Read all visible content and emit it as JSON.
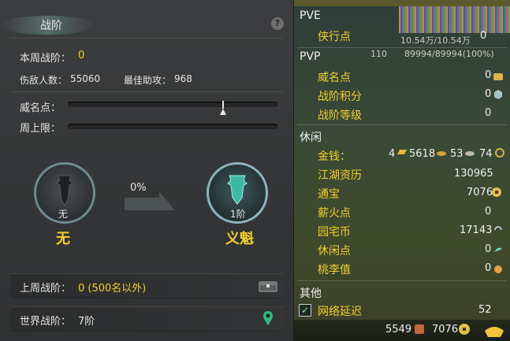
{
  "left": {
    "title": "战阶",
    "help": "?",
    "weekly_rank_label": "本周战阶：",
    "weekly_rank_value": "0",
    "kills_label": "伤敌人数：",
    "kills_value": "55060",
    "assists_label": "最佳助攻：",
    "assists_value": "968",
    "fame_label": "威名点：",
    "weekly_cap_label": "周上限：",
    "fame_progress": 0.74,
    "current_rank_small": "无",
    "current_rank_name": "无",
    "progress_percent": "0%",
    "next_rank_small": "1阶",
    "next_rank_name": "义魁",
    "last_week_label": "上周战阶：",
    "last_week_value": "0 (500名以外)",
    "world_label": "世界战阶：",
    "world_value": "7阶"
  },
  "right": {
    "header_fragment": "网络延迟：",
    "pve": "PVE",
    "pve_items": [
      {
        "label": "侠行点",
        "value": "0"
      }
    ],
    "overlay_text": "10.54万/10.54万",
    "overlay_hp": "89994/89994(100%)",
    "overlay_level": "110",
    "pvp": "PVP",
    "pvp_items": [
      {
        "label": "威名点",
        "value": "0"
      },
      {
        "label": "战阶积分",
        "value": "0"
      },
      {
        "label": "战阶等级",
        "value": "0"
      }
    ],
    "leisure": "休闲",
    "money_label": "金钱：",
    "money_gold": "4",
    "money_silver": "5618",
    "money_copper": "53",
    "money_other": "74",
    "leisure_items": [
      {
        "label": "江湖资历",
        "value": "130965"
      },
      {
        "label": "通宝",
        "value": "7076"
      },
      {
        "label": "薪火点",
        "value": "0"
      },
      {
        "label": "园宅币",
        "value": "17143"
      },
      {
        "label": "休闲点",
        "value": "0"
      },
      {
        "label": "桃李值",
        "value": "0"
      }
    ],
    "other": "其他",
    "latency_label": "网络延迟",
    "latency_value": "52",
    "bottom_a": "5549",
    "bottom_b": "7076"
  }
}
